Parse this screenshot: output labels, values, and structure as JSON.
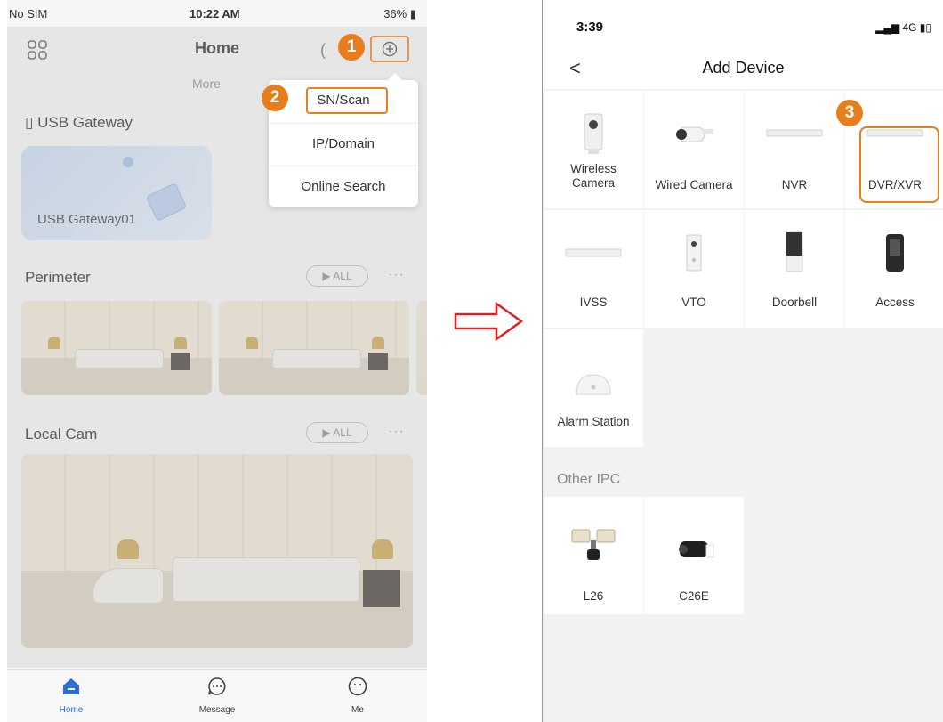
{
  "left_phone": {
    "status": {
      "carrier": "No SIM",
      "time": "10:22 AM",
      "battery": "36%"
    },
    "header": {
      "title": "Home"
    },
    "tabs_row": {
      "more": "More"
    },
    "dropdown": {
      "items": [
        "SN/Scan",
        "IP/Domain",
        "Online Search"
      ]
    },
    "sections": {
      "usb": {
        "title": "USB Gateway",
        "card_label": "USB Gateway01"
      },
      "perimeter": {
        "title": "Perimeter",
        "all_label": "▶ ALL"
      },
      "local_cam": {
        "title": "Local Cam",
        "all_label": "▶ ALL"
      }
    },
    "tabbar": [
      {
        "label": "Home",
        "icon": "home-icon"
      },
      {
        "label": "Message",
        "icon": "message-icon"
      },
      {
        "label": "Me",
        "icon": "me-icon"
      }
    ],
    "more_dots": "···"
  },
  "badges": {
    "one": "1",
    "two": "2",
    "three": "3"
  },
  "right_phone": {
    "status": {
      "time": "3:39",
      "network": "4G"
    },
    "nav": {
      "back": "<",
      "title": "Add Device"
    },
    "devices": [
      {
        "name": "Wireless Camera",
        "icon": "wireless-camera-icon"
      },
      {
        "name": "Wired Camera",
        "icon": "wired-camera-icon"
      },
      {
        "name": "NVR",
        "icon": "nvr-icon"
      },
      {
        "name": "DVR/XVR",
        "icon": "dvr-icon"
      },
      {
        "name": "IVSS",
        "icon": "ivss-icon"
      },
      {
        "name": "VTO",
        "icon": "vto-icon"
      },
      {
        "name": "Doorbell",
        "icon": "doorbell-icon"
      },
      {
        "name": "Access",
        "icon": "access-icon"
      },
      {
        "name": "Alarm Station",
        "icon": "alarm-station-icon"
      }
    ],
    "other_ipc": {
      "title": "Other IPC",
      "devices": [
        {
          "name": "L26",
          "icon": "floodlight-camera-icon"
        },
        {
          "name": "C26E",
          "icon": "bullet-camera-icon"
        }
      ]
    }
  },
  "colors": {
    "accent": "#e87d1e",
    "tab_active": "#2b6fd6",
    "arrow": "#e02020"
  }
}
